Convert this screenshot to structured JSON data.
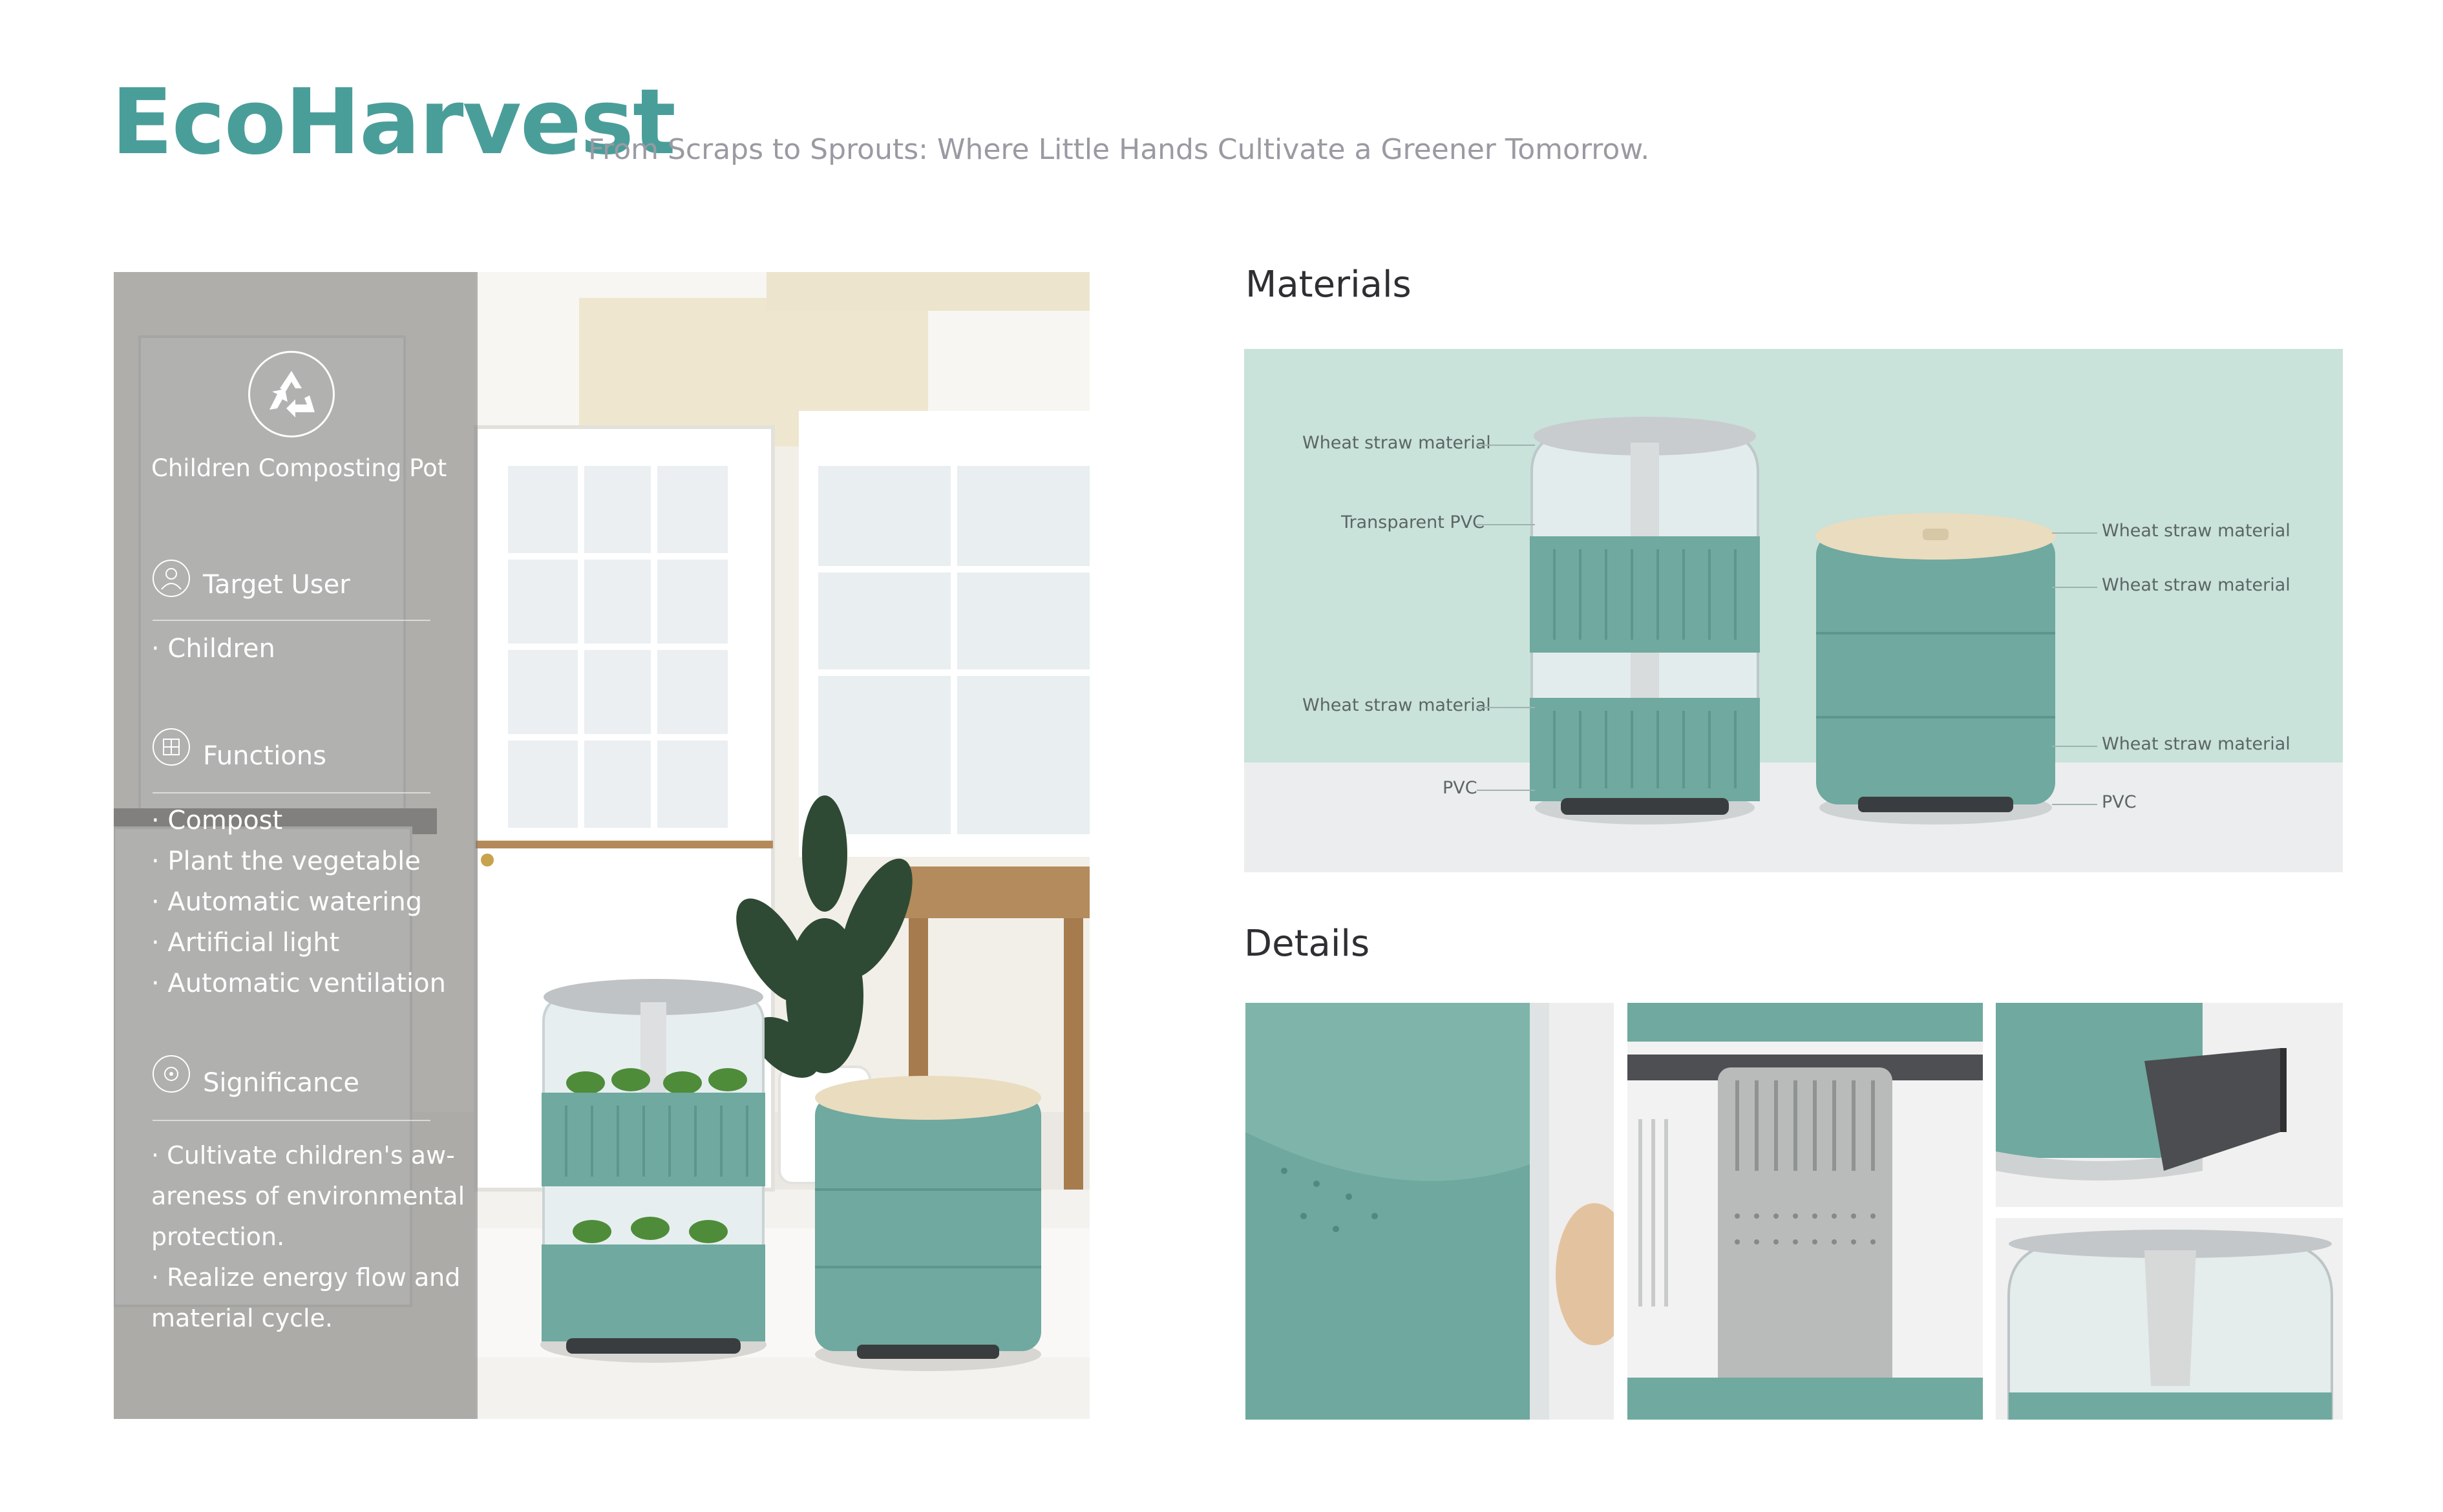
{
  "header": {
    "brand": "EcoHarvest",
    "tagline": "From Scraps to Sprouts: Where Little Hands Cultivate a Greener Tomorrow."
  },
  "info_panel": {
    "product_name": "Children Composting Pot",
    "target_user_heading": "Target User",
    "target_users": [
      "· Children"
    ],
    "functions_heading": "Functions",
    "functions": [
      "· Compost",
      "· Plant the vegetable",
      "· Automatic watering",
      "· Artificial light",
      "· Automatic ventilation"
    ],
    "significance_heading": "Significance",
    "significance_lines": [
      "· Cultivate children's aw-",
      "areness of environmental",
      "protection.",
      "· Realize energy flow and",
      "material cycle."
    ]
  },
  "materials": {
    "title": "Materials",
    "labels_left": [
      "Wheat straw material",
      "Transparent PVC",
      "Wheat straw material",
      "PVC"
    ],
    "labels_right": [
      "Wheat straw material",
      "Wheat straw material",
      "Wheat straw material",
      "PVC"
    ]
  },
  "details": {
    "title": "Details"
  },
  "colors": {
    "brand_teal": "#4a9e9a",
    "product_teal": "#6fa9a0",
    "mint_background": "#c9e2da"
  },
  "icons": [
    "recycle-icon",
    "user-icon",
    "functions-icon",
    "significance-icon"
  ]
}
